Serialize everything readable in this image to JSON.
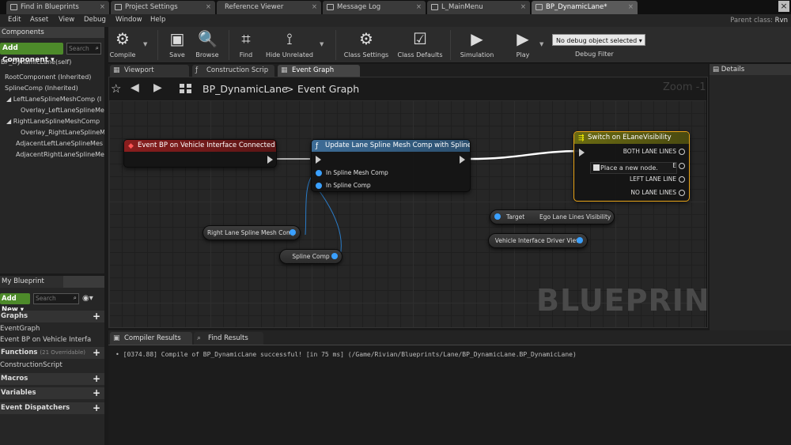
{
  "window": {
    "tabs": [
      {
        "label": "Find in Blueprints"
      },
      {
        "label": "Project Settings"
      },
      {
        "label": "Reference Viewer"
      },
      {
        "label": "Message Log"
      },
      {
        "label": "L_MainMenu"
      },
      {
        "label": "BP_DynamicLane*"
      }
    ],
    "close_glyph": "×",
    "parent_class_label": "Parent class:",
    "parent_class_value": "Rvn"
  },
  "menu": {
    "items": [
      "Edit",
      "Asset",
      "View",
      "Debug",
      "Window",
      "Help"
    ]
  },
  "toolbar": {
    "compile": "Compile",
    "save": "Save",
    "browse": "Browse",
    "find": "Find",
    "hide_unrelated": "Hide Unrelated",
    "class_settings": "Class Settings",
    "class_defaults": "Class Defaults",
    "simulation": "Simulation",
    "play": "Play",
    "debug_object": "No debug object selected ▾",
    "debug_filter": "Debug Filter"
  },
  "components": {
    "header": "Components",
    "add_button": "Add Component ▾",
    "search_placeholder": "Search",
    "self_label": "BP_DynamicLane(self)",
    "items": [
      {
        "label": "RootComponent (Inherited)"
      },
      {
        "label": "SplineComp (Inherited)"
      },
      {
        "label": "◢ LeftLaneSplineMeshComp (I"
      },
      {
        "label": "Overlay_LeftLaneSplineMe"
      },
      {
        "label": "◢ RightLaneSplineMeshComp"
      },
      {
        "label": "Overlay_RightLaneSplineM"
      },
      {
        "label": "AdjacentLeftLaneSplineMes"
      },
      {
        "label": "AdjacentRightLaneSplineMe"
      }
    ]
  },
  "my_blueprint": {
    "tab": "My Blueprint",
    "add_button": "Add New ▾",
    "search_placeholder": "Search",
    "graphs": "Graphs",
    "event_graph": "EventGraph",
    "event_item": "Event BP on Vehicle Interfa",
    "functions": "Functions",
    "functions_sub": "(21 Overridable)",
    "construction_script": "ConstructionScript",
    "macros": "Macros",
    "variables": "Variables",
    "dispatchers": "Event Dispatchers"
  },
  "editor_tabs": [
    {
      "label": "Viewport"
    },
    {
      "label": "Construction Scrip"
    },
    {
      "label": "Event Graph"
    }
  ],
  "graph": {
    "breadcrumb_root": "BP_DynamicLane",
    "breadcrumb_sep": ">",
    "breadcrumb_leaf": "Event Graph",
    "zoom": "Zoom -1",
    "watermark": "BLUEPRINT",
    "nodes": {
      "event": {
        "title": "Event BP on Vehicle Interface Connected",
        "color": "#8a1e1e"
      },
      "update": {
        "title": "Update Lane Spline Mesh Comp with Spline",
        "color": "#3d6c96",
        "pin1": "In Spline Mesh Comp",
        "pin2": "In Spline Comp"
      },
      "switch": {
        "title": "Switch on ELaneVisibility",
        "color": "#6a6a12",
        "both": "BOTH LANE LINES",
        "place": "Place a new node.",
        "e_label": "E",
        "left": "LEFT LANE LINE",
        "no": "NO LANE LINES"
      }
    },
    "vars": {
      "right_lane": "Right Lane Spline Mesh Comp",
      "spline_comp": "Spline Comp",
      "target": "Target",
      "ego": "Ego Lane Lines Visibility",
      "driver_view": "Vehicle Interface Driver View"
    }
  },
  "details": {
    "header": "Details"
  },
  "bottom": {
    "tabs": [
      {
        "label": "Compiler Results"
      },
      {
        "label": "Find Results"
      }
    ],
    "log": "• [0374.88] Compile of BP_DynamicLane successful! [in 75 ms] (/Game/Rivian/Blueprints/Lane/BP_DynamicLane.BP_DynamicLane)"
  }
}
